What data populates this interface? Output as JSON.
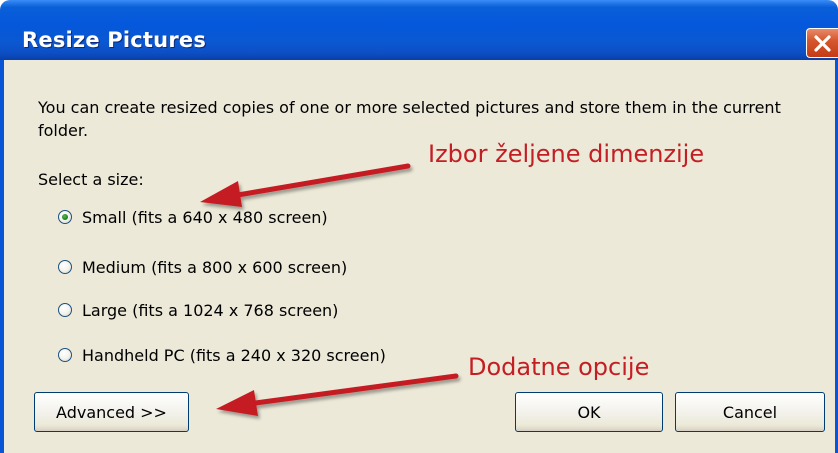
{
  "window": {
    "title": "Resize Pictures"
  },
  "icons": {
    "close": "close-icon"
  },
  "dialog": {
    "description": "You can create resized copies of one or more selected pictures and store them in the current folder.",
    "select_label": "Select a size:",
    "options": [
      {
        "label": "Small (fits a 640 x 480 screen)",
        "selected": true
      },
      {
        "label": "Medium (fits a 800 x 600 screen)",
        "selected": false
      },
      {
        "label": "Large (fits a 1024 x 768 screen)",
        "selected": false
      },
      {
        "label": "Handheld PC (fits a 240 x 320 screen)",
        "selected": false
      }
    ]
  },
  "buttons": {
    "advanced": "Advanced >>",
    "ok": "OK",
    "cancel": "Cancel"
  },
  "annotations": {
    "size_choice": "Izbor željene dimenzije",
    "extra_options": "Dodatne opcije",
    "color": "#c41e24"
  },
  "colors": {
    "titlebar": "#0558dc",
    "dialog_bg": "#ece9d8",
    "close_button": "#c33b16"
  }
}
